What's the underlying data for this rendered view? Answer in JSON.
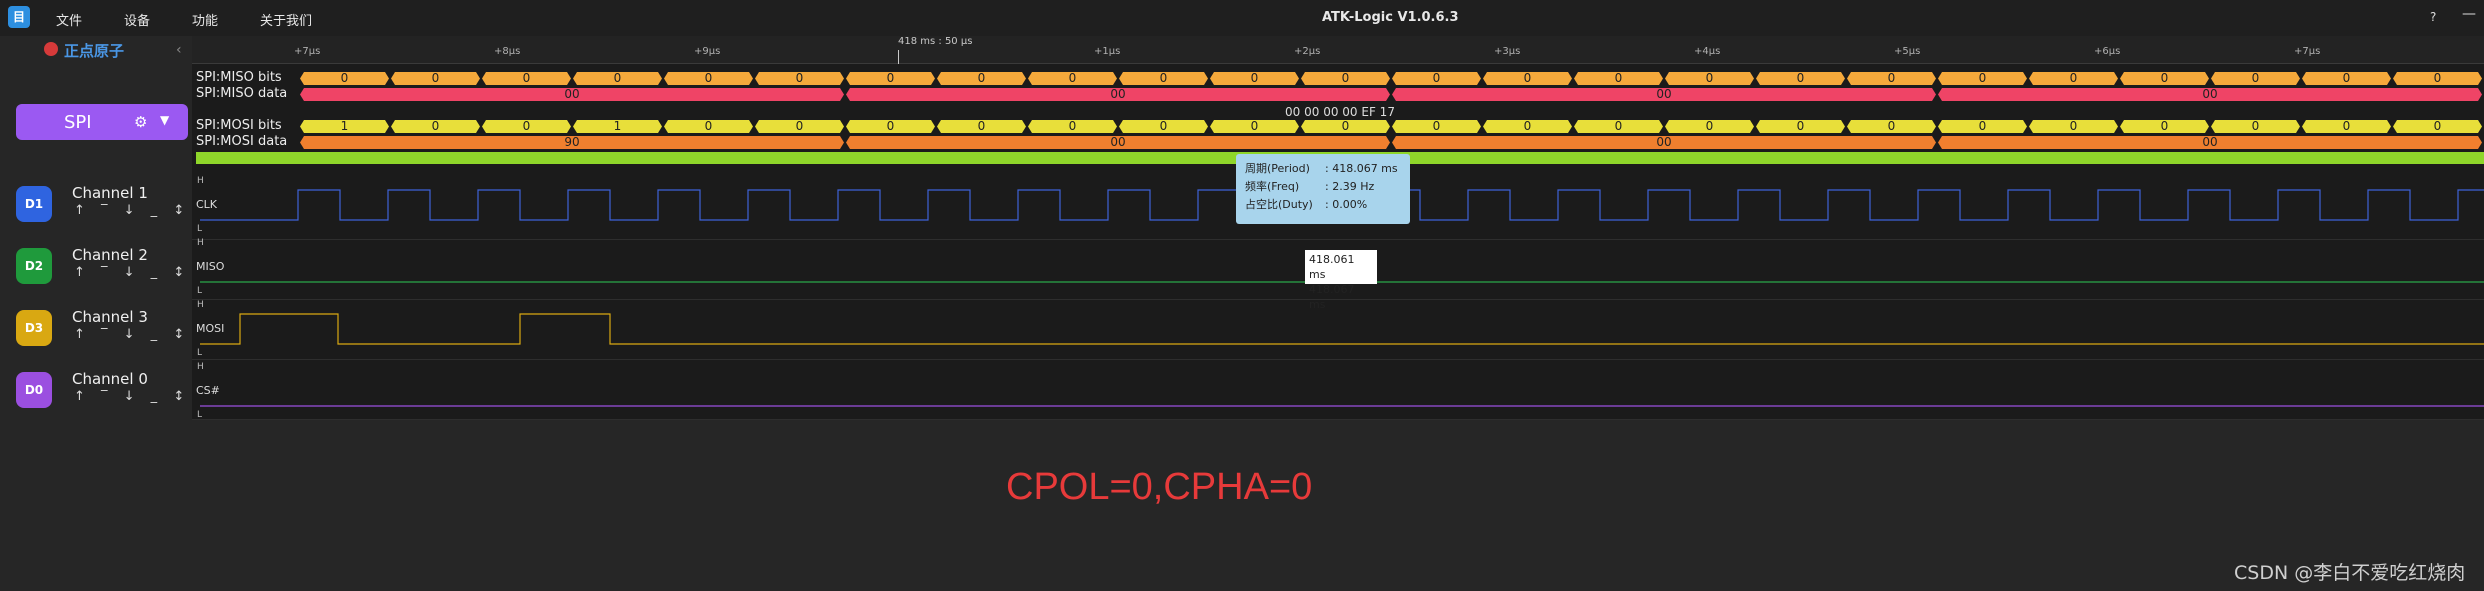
{
  "app": {
    "title": "ATK-Logic  V1.0.6.3",
    "logo_glyph": "目",
    "help": "?",
    "minimize": "—"
  },
  "menu": [
    "文件",
    "设备",
    "功能",
    "关于我们"
  ],
  "sidebar": {
    "brand": "正点原子",
    "collapse": "‹",
    "decoder": {
      "label": "SPI",
      "color": "#9b59f2"
    },
    "channels": [
      {
        "badge": "D1",
        "name": "Channel 1",
        "color": "#2f64e0",
        "signal": "CLK"
      },
      {
        "badge": "D2",
        "name": "Channel 2",
        "color": "#1f9a3c",
        "signal": "MISO"
      },
      {
        "badge": "D3",
        "name": "Channel 3",
        "color": "#d9a812",
        "signal": "MOSI"
      },
      {
        "badge": "D0",
        "name": "Channel 0",
        "color": "#9b4fe0",
        "signal": "CS#"
      }
    ],
    "trigger_icons": "↑ ‾ ↓ _ ↕"
  },
  "ruler": {
    "cursor": "418 ms : 50 μs",
    "ticks": [
      "+7μs",
      "+8μs",
      "+9μs",
      "+1μs",
      "+2μs",
      "+3μs",
      "+4μs",
      "+5μs",
      "+6μs",
      "+7μs"
    ]
  },
  "decoder_rows": {
    "miso_bits": {
      "label": "SPI:MISO bits",
      "values": [
        "0",
        "0",
        "0",
        "0",
        "0",
        "0",
        "0",
        "0",
        "0",
        "0",
        "0",
        "0",
        "0",
        "0",
        "0",
        "0",
        "0",
        "0",
        "0",
        "0",
        "0",
        "0",
        "0",
        "0"
      ],
      "color": "#f5a93b"
    },
    "miso_data": {
      "label": "SPI:MISO data",
      "values": [
        "00",
        "00",
        "00",
        "00"
      ],
      "color": "#ef4466"
    },
    "words": "00 00 00 00 EF 17",
    "mosi_bits": {
      "label": "SPI:MOSI bits",
      "values": [
        "1",
        "0",
        "0",
        "1",
        "0",
        "0",
        "0",
        "0",
        "0",
        "0",
        "0",
        "0",
        "0",
        "0",
        "0",
        "0",
        "0",
        "0",
        "0",
        "0",
        "0",
        "0",
        "0",
        "0"
      ],
      "color": "#e8df3a"
    },
    "mosi_data": {
      "label": "SPI:MOSI data",
      "values": [
        "90",
        "00",
        "00",
        "00"
      ],
      "color": "#f07f2e"
    }
  },
  "tooltip": {
    "period_k": "周期(Period)",
    "period_v": ": 418.067 ms",
    "freq_k": "频率(Freq)",
    "freq_v": ": 2.39 Hz",
    "duty_k": "占空比(Duty)",
    "duty_v": ": 0.00%"
  },
  "measure": {
    "a": "418.061 ms",
    "b": "418.067 ms"
  },
  "level_high": "H",
  "level_low": "L",
  "caption": "CPOL=0,CPHA=0",
  "watermark": "CSDN @李白不爱吃红烧肉"
}
